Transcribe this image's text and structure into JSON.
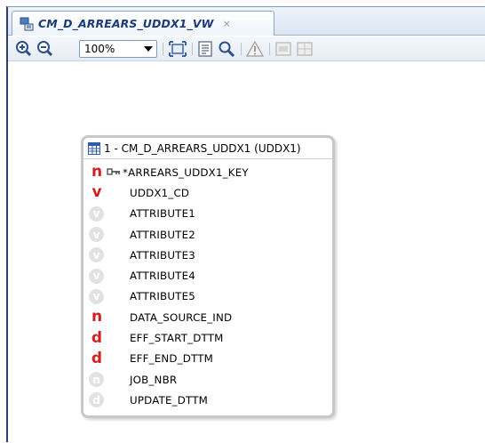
{
  "tab": {
    "title": "CM_D_ARREARS_UDDX1_VW",
    "close_glyph": "×",
    "icon": "view-diagram-icon"
  },
  "toolbar": {
    "zoom_in_icon": "zoom-in-icon",
    "zoom_out_icon": "zoom-out-icon",
    "zoom_value": "100%",
    "fit_icon": "fit-to-window-icon",
    "properties_icon": "properties-icon",
    "find_icon": "find-icon",
    "warning_icon": "warning-icon",
    "layout_icon": "layout-icon",
    "grid_icon": "grid-icon"
  },
  "table_node": {
    "title": "1 - CM_D_ARREARS_UDDX1 (UDDX1)",
    "icon": "table-icon",
    "columns": [
      {
        "badge": "n",
        "style": "red",
        "pk": true,
        "name": "*ARREARS_UDDX1_KEY"
      },
      {
        "badge": "v",
        "style": "red",
        "pk": false,
        "name": "UDDX1_CD"
      },
      {
        "badge": "v",
        "style": "grey",
        "pk": false,
        "name": "ATTRIBUTE1"
      },
      {
        "badge": "v",
        "style": "grey",
        "pk": false,
        "name": "ATTRIBUTE2"
      },
      {
        "badge": "v",
        "style": "grey",
        "pk": false,
        "name": "ATTRIBUTE3"
      },
      {
        "badge": "v",
        "style": "grey",
        "pk": false,
        "name": "ATTRIBUTE4"
      },
      {
        "badge": "v",
        "style": "grey",
        "pk": false,
        "name": "ATTRIBUTE5"
      },
      {
        "badge": "n",
        "style": "red",
        "pk": false,
        "name": "DATA_SOURCE_IND"
      },
      {
        "badge": "d",
        "style": "red",
        "pk": false,
        "name": "EFF_START_DTTM"
      },
      {
        "badge": "d",
        "style": "red",
        "pk": false,
        "name": "EFF_END_DTTM"
      },
      {
        "badge": "n",
        "style": "grey",
        "pk": false,
        "name": "JOB_NBR"
      },
      {
        "badge": "d",
        "style": "grey",
        "pk": false,
        "name": "UPDATE_DTTM"
      }
    ]
  }
}
